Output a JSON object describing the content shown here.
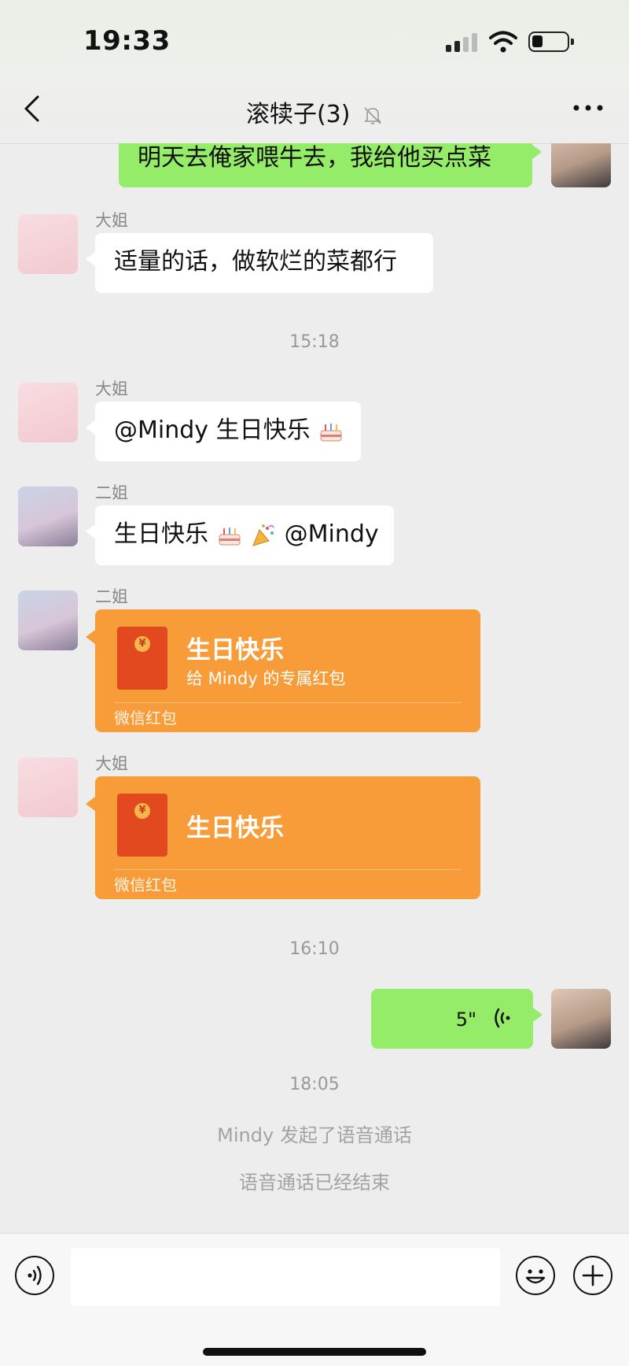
{
  "status_bar": {
    "time": "19:33"
  },
  "header": {
    "title": "滚犊子(3)"
  },
  "messages": {
    "m0": {
      "text": "明天去俺家喂牛去，我给他买点菜"
    },
    "m1": {
      "sender": "大姐",
      "text": "适量的话，做软烂的菜都行"
    },
    "t1": "15:18",
    "m2": {
      "sender": "大姐",
      "text": "@Mindy 生日快乐"
    },
    "m3": {
      "sender": "二姐",
      "text_a": "生日快乐",
      "text_b": "@Mindy"
    },
    "m4": {
      "sender": "二姐",
      "title": "生日快乐",
      "subtitle": "给 Mindy 的专属红包",
      "footer": "微信红包"
    },
    "m5": {
      "sender": "大姐",
      "title": "生日快乐",
      "footer": "微信红包"
    },
    "t2": "16:10",
    "m6": {
      "duration": "5\""
    },
    "t3": "18:05",
    "s1": "Mindy 发起了语音通话",
    "s2": "语音通话已经结束"
  },
  "input_bar": {
    "placeholder": ""
  },
  "colors": {
    "my_bubble": "#95ec69",
    "red_packet": "#f79c38",
    "background": "#ededed"
  },
  "icons": [
    "back-arrow-icon",
    "mute-bell-icon",
    "more-icon",
    "voice-icon",
    "emoji-icon",
    "plus-icon",
    "cake-emoji",
    "party-popper-emoji",
    "red-packet-icon",
    "voice-wave-icon"
  ]
}
